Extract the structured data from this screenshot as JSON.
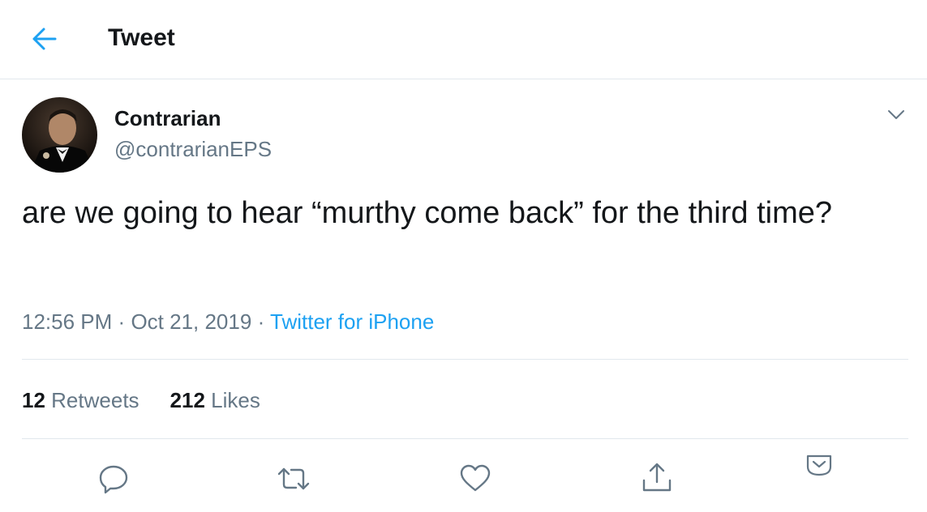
{
  "header": {
    "title": "Tweet",
    "back_icon": "arrow-left-icon"
  },
  "colors": {
    "accent": "#1da1f2",
    "text": "#14171a",
    "secondary_text": "#657786",
    "divider": "#e1e8ed"
  },
  "tweet": {
    "author": {
      "name": "Contrarian",
      "handle": "@contrarianEPS"
    },
    "text": "are we going to hear “murthy come back” for the third time?",
    "time": "12:56 PM",
    "date": "Oct 21, 2019",
    "separator": "·",
    "source": "Twitter for iPhone",
    "stats": {
      "retweets_count": "12",
      "retweets_label": "Retweets",
      "likes_count": "212",
      "likes_label": "Likes"
    }
  },
  "actions": [
    {
      "name": "reply",
      "icon": "reply-icon"
    },
    {
      "name": "retweet",
      "icon": "retweet-icon"
    },
    {
      "name": "like",
      "icon": "heart-icon"
    },
    {
      "name": "share",
      "icon": "share-icon"
    },
    {
      "name": "more",
      "icon": "chevron-down-icon"
    }
  ]
}
